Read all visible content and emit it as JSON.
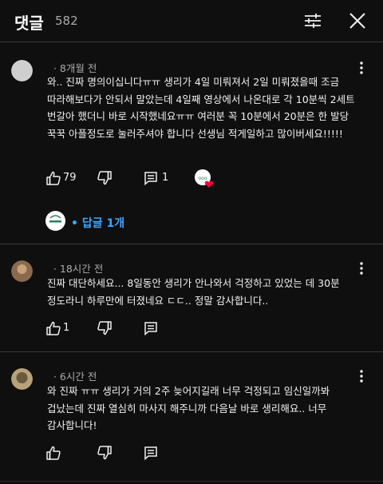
{
  "header": {
    "title": "댓글",
    "count": "582"
  },
  "comments": [
    {
      "author": "",
      "time": "8개월 전",
      "meta_display": "  · 8개월 전",
      "text": "와.. 진짜 명의이십니다ㅠㅠ 생리가 4일 미뤄져서 2일 미뤄졌을때 조금 따라해보다가 안되서 말았는데 4일째 영상에서 나온대로 각 10분씩 2세트 번갈아 했더니 바로 시작했네요ㅠㅠ 여러분 꼭 10분에서 20분은 한 발당 꾹꾹 아플정도로 눌러주셔야 합니다 선생님 적게일하고 많이버세요!!!!!",
      "likes": "79",
      "reply_count": "1",
      "creator_heart": true,
      "replies_label": "• 답글 1개",
      "avatar_color": "#cfcfcf"
    },
    {
      "author": "",
      "time": "18시간 전",
      "meta_display": "  · 18시간 전",
      "text": "진짜 대단하세요... 8일동안 생리가 안나와서 걱정하고 있었는 데 30분 정도라니 하루만에 터졌네요 ㄷㄷ.. 정말 감사합니다..",
      "likes": "1",
      "avatar_color": "#8a6a4e"
    },
    {
      "author": "",
      "time": "6시간 전",
      "meta_display": "  · 6시간 전",
      "text": "와 진짜 ㅠㅠ 생리가 거의 2주 늦어지길래 너무 걱정되고 임신일까봐 겁났는데 진짜 열심히 마사지 해주니까 다음날 바로 생리해요.. 너무 감사합니다!",
      "avatar_color": "#b8a27a"
    }
  ],
  "icons": {
    "filter": "tune-icon",
    "close": "close-icon",
    "more": "more-vert-icon",
    "like": "thumb-up-icon",
    "dislike": "thumb-down-icon",
    "reply": "comment-icon",
    "heart": "creator-heart-icon"
  },
  "colors": {
    "background": "#0f0f0f",
    "text": "#f1f1f1",
    "secondary": "#aaaaaa",
    "link": "#3ea6ff",
    "heart": "#ff0033"
  }
}
